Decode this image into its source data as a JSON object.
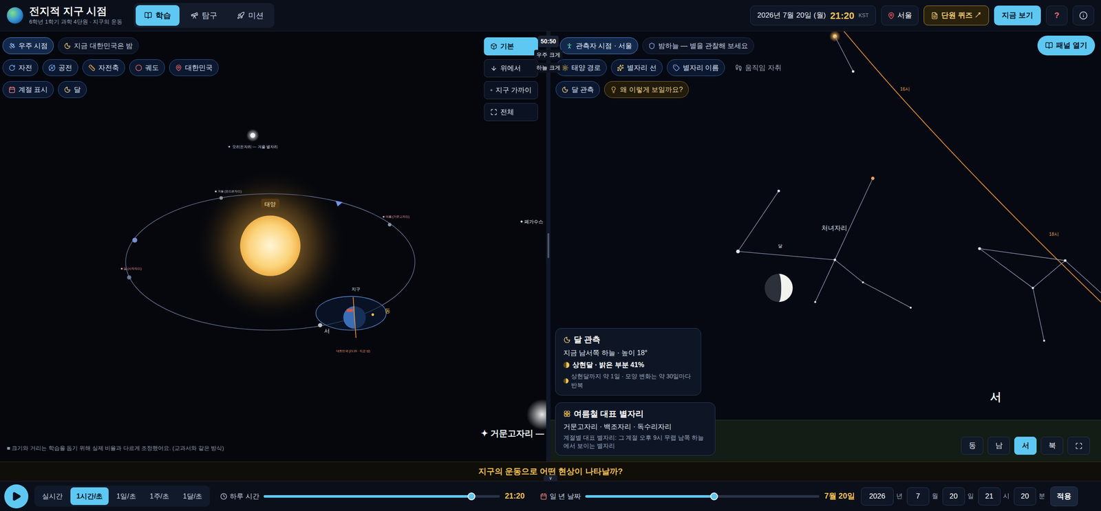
{
  "app": {
    "title": "전지적 지구 시점",
    "subtitle": "6학년 1학기 과학 4단원 · 지구의 운동"
  },
  "tabs": [
    {
      "label": "학습",
      "selected": true
    },
    {
      "label": "탐구",
      "selected": false
    },
    {
      "label": "미션",
      "selected": false
    }
  ],
  "header": {
    "date": "2026년 7월 20일 (월)",
    "time": "21:20",
    "timezone": "KST",
    "location": "서울",
    "quiz": "단원 퀴즈 ↗",
    "now_button": "지금 보기",
    "help_button": "?"
  },
  "space_view": {
    "mode_chips": [
      {
        "label": "우주 시점",
        "selected": true
      },
      {
        "label": "지금 대한민국은 밤",
        "selected": false
      }
    ],
    "toggles": [
      {
        "label": "자전",
        "on": true
      },
      {
        "label": "공전",
        "on": true
      },
      {
        "label": "자전축",
        "on": true
      },
      {
        "label": "궤도",
        "on": true
      },
      {
        "label": "대한민국",
        "on": true
      }
    ],
    "toggles2": [
      {
        "label": "계절 표시",
        "on": true
      },
      {
        "label": "달",
        "on": true
      }
    ],
    "view_buttons": [
      {
        "label": "기본",
        "selected": true
      },
      {
        "label": "위에서",
        "selected": false
      },
      {
        "label": "지구 가까이",
        "selected": false
      },
      {
        "label": "전체",
        "selected": false
      }
    ],
    "labels": {
      "sun": "태양",
      "earth": "지구",
      "east": "동",
      "west": "서",
      "orion": "✦ 오리온자리 — 겨울 별자리",
      "korea": "대한민국 (21:20 · 지금 밤)",
      "pegasus": "✦ 페가수스",
      "lyra": "✦ 거문고자리 —"
    },
    "season_labels": [
      "■ 봄 (사자자리)",
      "■ 겨울 (오리온자리)",
      "■ 여름 (거문고자리)"
    ],
    "note": "■ 크기와 거리는 학습을 돕기 위해 실제 비율과 다르게 조정했어요. (교과서와 같은 방식)"
  },
  "split": {
    "ratio": "50:50",
    "space_bigger": "우주 크게",
    "sky_bigger": "하늘 크게"
  },
  "sky_view": {
    "mode_chips": [
      {
        "label": "관측자 시점 · 서울",
        "selected": true
      },
      {
        "label": "밤하늘 — 별을 관찰해 보세요",
        "selected": false
      }
    ],
    "toggles": [
      {
        "label": "태양 경로",
        "on": true
      },
      {
        "label": "별자리 선",
        "on": true
      },
      {
        "label": "별자리 이름",
        "on": true
      },
      {
        "label": "움직임 자취",
        "on": false
      }
    ],
    "toggles2": [
      {
        "label": "달 관측",
        "on": true
      }
    ],
    "why_button": "왜 이렇게 보일까요?",
    "panel_button": "패널 열기",
    "labels": {
      "constellation": "처녀자리",
      "moon": "달",
      "hour16": "16시",
      "hour18": "18시",
      "direction": "서"
    },
    "directions": [
      {
        "label": "동",
        "selected": false
      },
      {
        "label": "남",
        "selected": false
      },
      {
        "label": "서",
        "selected": true
      },
      {
        "label": "북",
        "selected": false
      }
    ],
    "moon_card": {
      "title": "달 관측",
      "position": "지금 남서쪽 하늘 · 높이 18°",
      "phase": "상현달 · 밝은 부분 41%",
      "lit": 0.41,
      "note": "상현달까지 약 1일 · 모양 변화는 약 30일마다 반복"
    },
    "season_card": {
      "title": "여름철 대표 별자리",
      "names": "거문고자리 · 백조자리 · 독수리자리",
      "note": "계절별 대표 별자리: 그 계절 오후 9시 무렵 남쪽 하늘에서 보이는 별자리"
    }
  },
  "banner": {
    "question": "지구의 운동으로 어떤 현상이 나타날까?",
    "toggle": "∨"
  },
  "controls": {
    "speeds": [
      {
        "label": "실시간",
        "selected": false
      },
      {
        "label": "1시간/초",
        "selected": true
      },
      {
        "label": "1일/초",
        "selected": false
      },
      {
        "label": "1주/초",
        "selected": false
      },
      {
        "label": "1달/초",
        "selected": false
      }
    ],
    "day": {
      "label": "하루 시간",
      "level": 0.88,
      "reading": "21:20"
    },
    "year": {
      "label": "일 년 날짜",
      "level": 0.55,
      "reading": "7월 20일"
    },
    "fields": [
      {
        "value": "2026",
        "unit": "년"
      },
      {
        "value": "7",
        "unit": "월"
      },
      {
        "value": "20",
        "unit": "일"
      },
      {
        "value": "21",
        "unit": "시"
      },
      {
        "value": "20",
        "unit": "분"
      }
    ],
    "apply": "적용"
  }
}
